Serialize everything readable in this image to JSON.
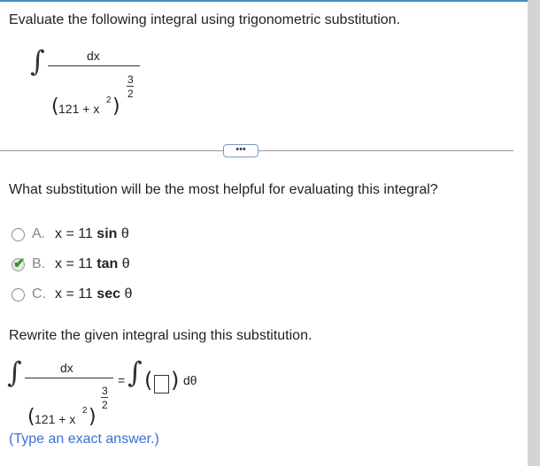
{
  "problem": {
    "prompt": "Evaluate the following integral using trigonometric substitution.",
    "integral_symbol": "∫",
    "numerator": "dx",
    "base": "121 + x",
    "inner_exponent": "2",
    "outer_exp_num": "3",
    "outer_exp_den": "2"
  },
  "more_button": "•••",
  "question": "What substitution will be the most helpful for evaluating this integral?",
  "options": [
    {
      "letter": "A.",
      "prefix": "x = 11 ",
      "func": "sin",
      "var": " θ",
      "selected": false
    },
    {
      "letter": "B.",
      "prefix": "x = 11 ",
      "func": "tan",
      "var": " θ",
      "selected": true
    },
    {
      "letter": "C.",
      "prefix": "x = 11 ",
      "func": "sec",
      "var": " θ",
      "selected": false
    }
  ],
  "rewrite": {
    "prompt": "Rewrite the given integral using this substitution.",
    "equals": "=",
    "d_theta": "dθ",
    "answer_value": "",
    "hint": "(Type an exact answer.)"
  }
}
